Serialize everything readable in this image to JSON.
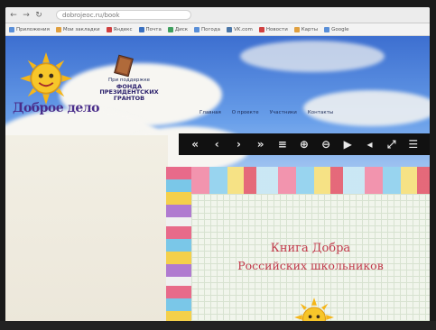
{
  "browser": {
    "url": "dobrojeoc.ru/book",
    "bookmarks": [
      {
        "label": "Приложения",
        "color": "#5a8fd8"
      },
      {
        "label": "Мои закладки",
        "color": "#e0a040"
      },
      {
        "label": "Яндекс",
        "color": "#d04040"
      },
      {
        "label": "Почта",
        "color": "#3a70c0"
      },
      {
        "label": "Диск",
        "color": "#40a060"
      },
      {
        "label": "Погода",
        "color": "#5a8fd8"
      },
      {
        "label": "VK.com",
        "color": "#4a76a8"
      },
      {
        "label": "Новости",
        "color": "#d04040"
      },
      {
        "label": "Карты",
        "color": "#e0a040"
      },
      {
        "label": "Google",
        "color": "#5a8fd8"
      }
    ]
  },
  "site": {
    "logo_text": "Доброе дело",
    "fund_lines": [
      "При поддержке",
      "ФОНДА",
      "ПРЕЗИДЕНТСКИХ",
      "ГРАНТОВ"
    ],
    "menu": [
      "Главная",
      "О проекте",
      "Участники",
      "Контакты"
    ]
  },
  "reader": {
    "controls": [
      {
        "name": "first-page-icon",
        "glyph": "«"
      },
      {
        "name": "prev-page-icon",
        "glyph": "‹"
      },
      {
        "name": "next-page-icon",
        "glyph": "›"
      },
      {
        "name": "last-page-icon",
        "glyph": "»"
      },
      {
        "name": "thumbnails-icon",
        "glyph": "≡"
      },
      {
        "name": "zoom-in-icon",
        "glyph": "⊕"
      },
      {
        "name": "zoom-out-icon",
        "glyph": "⊖"
      },
      {
        "name": "play-icon",
        "glyph": "▶"
      },
      {
        "name": "sound-icon",
        "glyph": "◂"
      },
      {
        "name": "fullscreen-icon",
        "glyph": "⤢"
      },
      {
        "name": "menu-icon",
        "glyph": "☰"
      }
    ]
  },
  "book": {
    "title_line1": "Книга Добра",
    "title_line2": "Российских школьников"
  }
}
